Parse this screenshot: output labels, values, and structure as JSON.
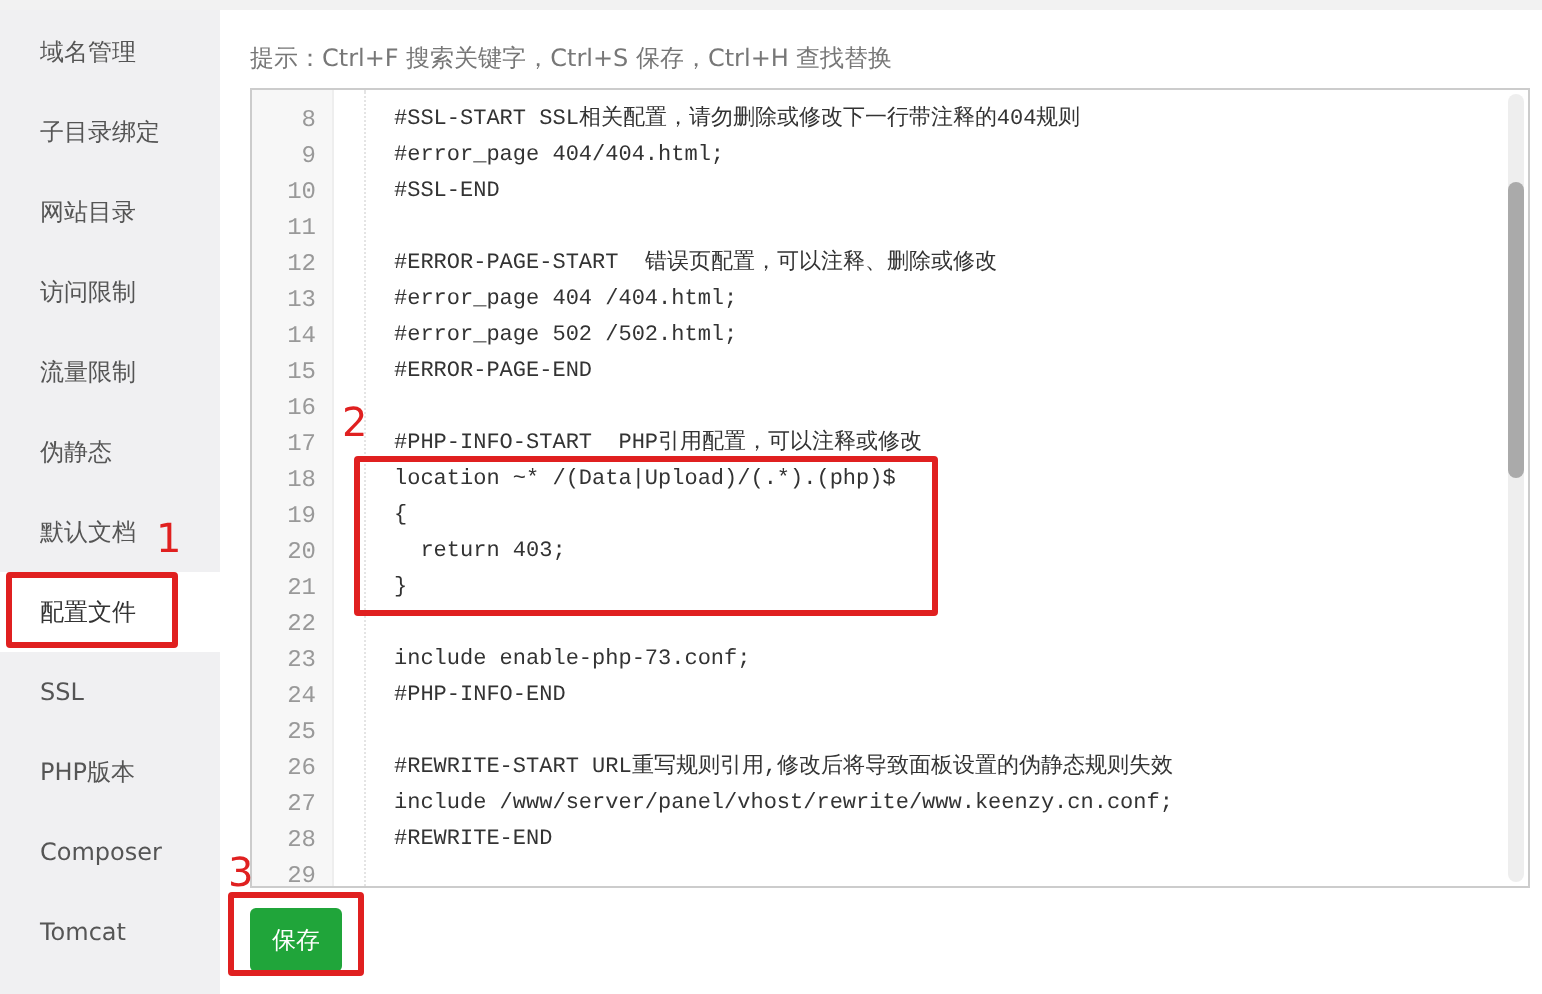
{
  "sidebar": {
    "items": [
      {
        "label": "域名管理",
        "selected": false
      },
      {
        "label": "子目录绑定",
        "selected": false
      },
      {
        "label": "网站目录",
        "selected": false
      },
      {
        "label": "访问限制",
        "selected": false
      },
      {
        "label": "流量限制",
        "selected": false
      },
      {
        "label": "伪静态",
        "selected": false
      },
      {
        "label": "默认文档",
        "selected": false
      },
      {
        "label": "配置文件",
        "selected": true
      },
      {
        "label": "SSL",
        "selected": false
      },
      {
        "label": "PHP版本",
        "selected": false
      },
      {
        "label": "Composer",
        "selected": false
      },
      {
        "label": "Tomcat",
        "selected": false
      }
    ]
  },
  "hint": "提示：Ctrl+F 搜索关键字，Ctrl+S 保存，Ctrl+H 查找替换",
  "editor": {
    "lines": [
      {
        "number": "8",
        "code": "#SSL-START SSL相关配置，请勿删除或修改下一行带注释的404规则"
      },
      {
        "number": "9",
        "code": "#error_page 404/404.html;"
      },
      {
        "number": "10",
        "code": "#SSL-END"
      },
      {
        "number": "11"
      },
      {
        "number": "12",
        "code": "#ERROR-PAGE-START  错误页配置，可以注释、删除或修改"
      },
      {
        "number": "13",
        "code": "#error_page 404 /404.html;"
      },
      {
        "number": "14",
        "code": "#error_page 502 /502.html;"
      },
      {
        "number": "15",
        "code": "#ERROR-PAGE-END"
      },
      {
        "number": "16"
      },
      {
        "number": "17",
        "code": "#PHP-INFO-START  PHP引用配置，可以注释或修改"
      },
      {
        "number": "18",
        "code": "location ~* /(Data|Upload)/(.*).(php)$"
      },
      {
        "number": "19",
        "code": "{"
      },
      {
        "number": "20",
        "code": "  return 403;"
      },
      {
        "number": "21",
        "code": "}"
      },
      {
        "number": "22"
      },
      {
        "number": "23",
        "code": "include enable-php-73.conf;"
      },
      {
        "number": "24",
        "code": "#PHP-INFO-END"
      },
      {
        "number": "25"
      },
      {
        "number": "26",
        "code": "#REWRITE-START URL重写规则引用,修改后将导致面板设置的伪静态规则失效"
      },
      {
        "number": "27",
        "code": "include /www/server/panel/vhost/rewrite/www.keenzy.cn.conf;"
      },
      {
        "number": "28",
        "code": "#REWRITE-END"
      },
      {
        "number": "29"
      }
    ]
  },
  "save_button": "保存",
  "callouts": [
    {
      "label": "1",
      "kind": "sidebar"
    },
    {
      "label": "2",
      "kind": "code"
    },
    {
      "label": "3",
      "kind": "button"
    }
  ]
}
